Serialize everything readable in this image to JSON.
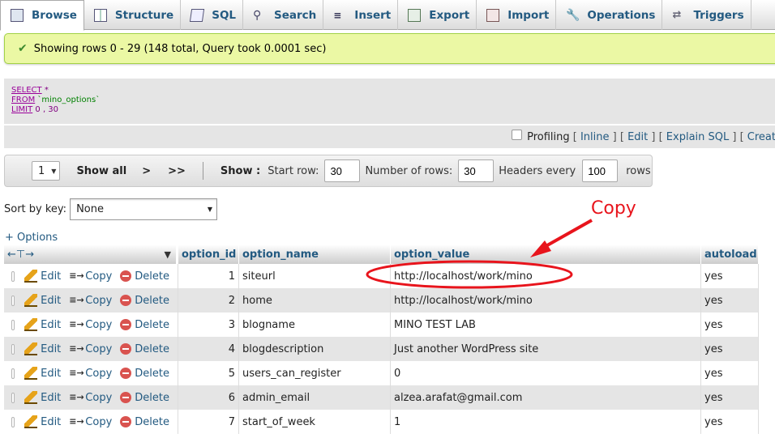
{
  "tabs": [
    {
      "label": "Browse",
      "icon": "browse-icon"
    },
    {
      "label": "Structure",
      "icon": "structure-icon"
    },
    {
      "label": "SQL",
      "icon": "sql-icon"
    },
    {
      "label": "Search",
      "icon": "search-icon"
    },
    {
      "label": "Insert",
      "icon": "insert-icon"
    },
    {
      "label": "Export",
      "icon": "export-icon"
    },
    {
      "label": "Import",
      "icon": "import-icon"
    },
    {
      "label": "Operations",
      "icon": "operations-icon"
    },
    {
      "label": "Triggers",
      "icon": "triggers-icon"
    }
  ],
  "message": {
    "text": "Showing rows 0 - 29 (148 total, Query took 0.0001 sec)"
  },
  "sql": {
    "select_kw": "SELECT",
    "select_val": "*",
    "from_kw": "FROM",
    "from_val": "`mino_options`",
    "limit_kw": "LIMIT",
    "limit_val": "0 , 30"
  },
  "sqlbar": {
    "profiling": "Profiling",
    "inline": "Inline",
    "edit": "Edit",
    "explain": "Explain SQL",
    "create": "Create"
  },
  "nav": {
    "page": "1",
    "show_all": "Show all",
    "next": ">",
    "last": ">>",
    "show_label": "Show :",
    "start_row_label": "Start row:",
    "start_row": "30",
    "num_rows_label": "Number of rows:",
    "num_rows": "30",
    "headers_label": "Headers every",
    "headers_every": "100",
    "rows_label": "rows"
  },
  "sort": {
    "label": "Sort by key:",
    "value": "None"
  },
  "options_link": "+ Options",
  "table": {
    "columns": [
      "option_id",
      "option_name",
      "option_value",
      "autoload"
    ],
    "actions": {
      "edit": "Edit",
      "copy": "Copy",
      "delete": "Delete"
    },
    "rows": [
      {
        "id": "1",
        "name": "siteurl",
        "value": "http://localhost/work/mino",
        "autoload": "yes"
      },
      {
        "id": "2",
        "name": "home",
        "value": "http://localhost/work/mino",
        "autoload": "yes"
      },
      {
        "id": "3",
        "name": "blogname",
        "value": "MINO TEST LAB",
        "autoload": "yes"
      },
      {
        "id": "4",
        "name": "blogdescription",
        "value": "Just another WordPress site",
        "autoload": "yes"
      },
      {
        "id": "5",
        "name": "users_can_register",
        "value": "0",
        "autoload": "yes"
      },
      {
        "id": "6",
        "name": "admin_email",
        "value": "alzea.arafat@gmail.com",
        "autoload": "yes"
      },
      {
        "id": "7",
        "name": "start_of_week",
        "value": "1",
        "autoload": "yes"
      }
    ]
  },
  "annotation": {
    "text": "Copy",
    "color": "#e8141c"
  }
}
